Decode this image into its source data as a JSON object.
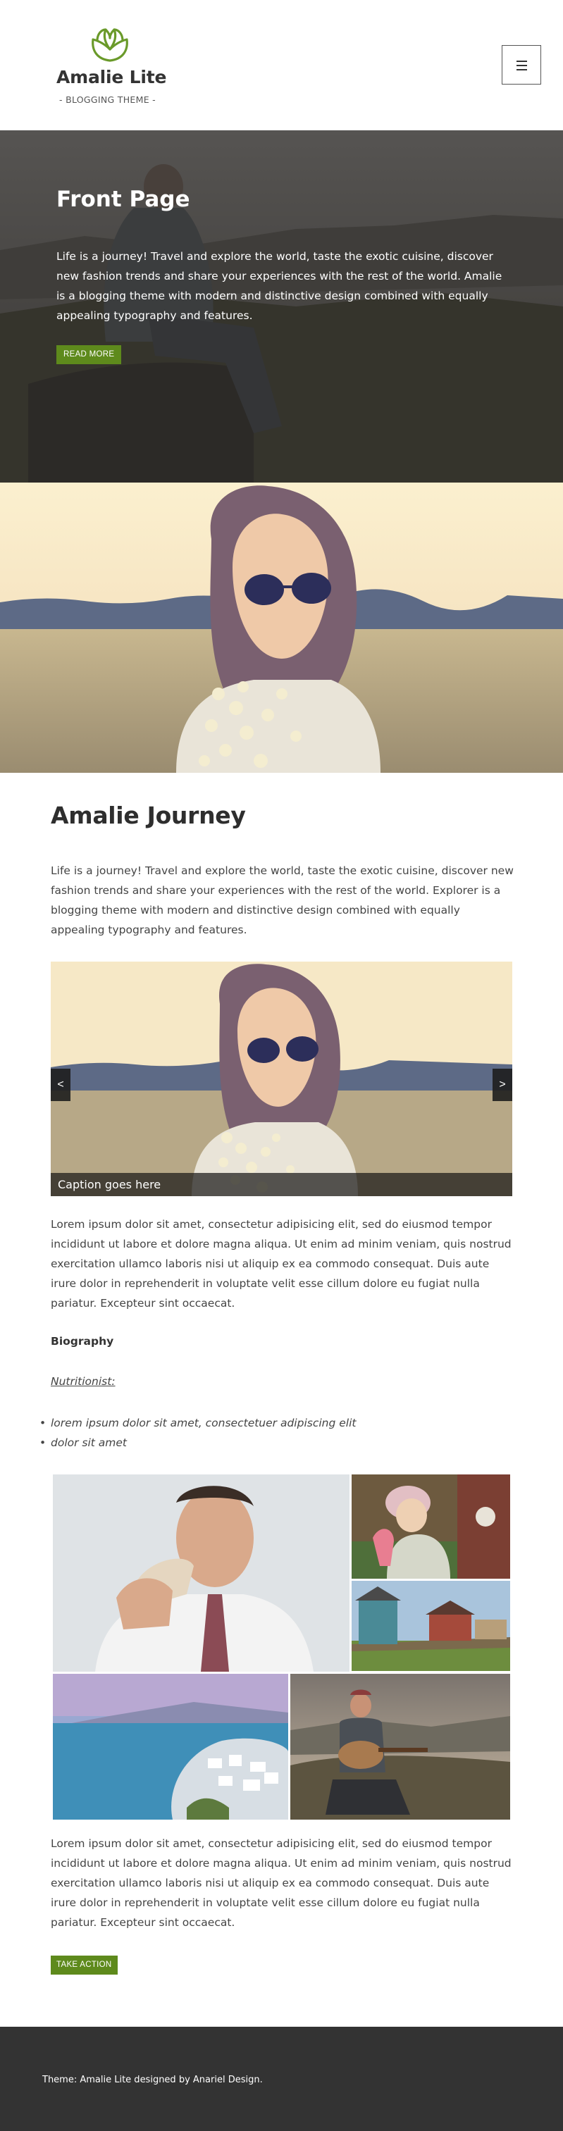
{
  "header": {
    "site_title": "Amalie Lite",
    "tagline": "- BLOGGING THEME -",
    "menu_icon": "hamburger-icon",
    "logo_icon": "rose-logo-icon",
    "brand_color": "#6a9a2a"
  },
  "hero": {
    "title": "Front Page",
    "text": "Life is a journey! Travel and explore the world, taste the exotic cuisine, discover new fashion trends and share your experiences with the rest of the world. Amalie is a blogging theme with modern and distinctive design combined with equally appealing typography and features.",
    "button_label": "READ MORE",
    "button_color": "#5e8a1c"
  },
  "article": {
    "title": "Amalie Journey",
    "intro": "Life is a journey! Travel and explore the world, taste the exotic cuisine, discover new fashion trends and share your experiences with the rest of the world. Explorer is a blogging theme with modern and distinctive design combined with equally appealing typography and features.",
    "slider": {
      "caption": "Caption goes here",
      "prev_label": "<",
      "next_label": ">"
    },
    "paragraph_1": "Lorem ipsum dolor sit amet, consectetur adipisicing elit, sed do eiusmod tempor incididunt ut labore et dolore magna aliqua. Ut enim ad minim veniam, quis nostrud exercitation ullamco laboris nisi ut aliquip ex ea commodo consequat. Duis aute irure dolor in reprehenderit in voluptate velit esse cillum dolore eu fugiat nulla pariatur. Excepteur sint occaecat.",
    "bio_heading": "Biography",
    "nutritionist": "Nutritionist:",
    "list_items": [
      "lorem ipsum dolor sit amet, consectetuer adipiscing elit",
      "dolor sit amet"
    ],
    "paragraph_2": "Lorem ipsum dolor sit amet, consectetur adipisicing elit, sed do eiusmod tempor incididunt ut labore et dolore magna aliqua. Ut enim ad minim veniam, quis nostrud exercitation ullamco laboris nisi ut aliquip ex ea commodo consequat. Duis aute irure dolor in reprehenderit in voluptate velit esse cillum dolore eu fugiat nulla pariatur. Excepteur sint occaecat.",
    "cta_label": "TAKE ACTION"
  },
  "footer": {
    "text": "Theme: Amalie Lite designed by Anariel Design."
  }
}
